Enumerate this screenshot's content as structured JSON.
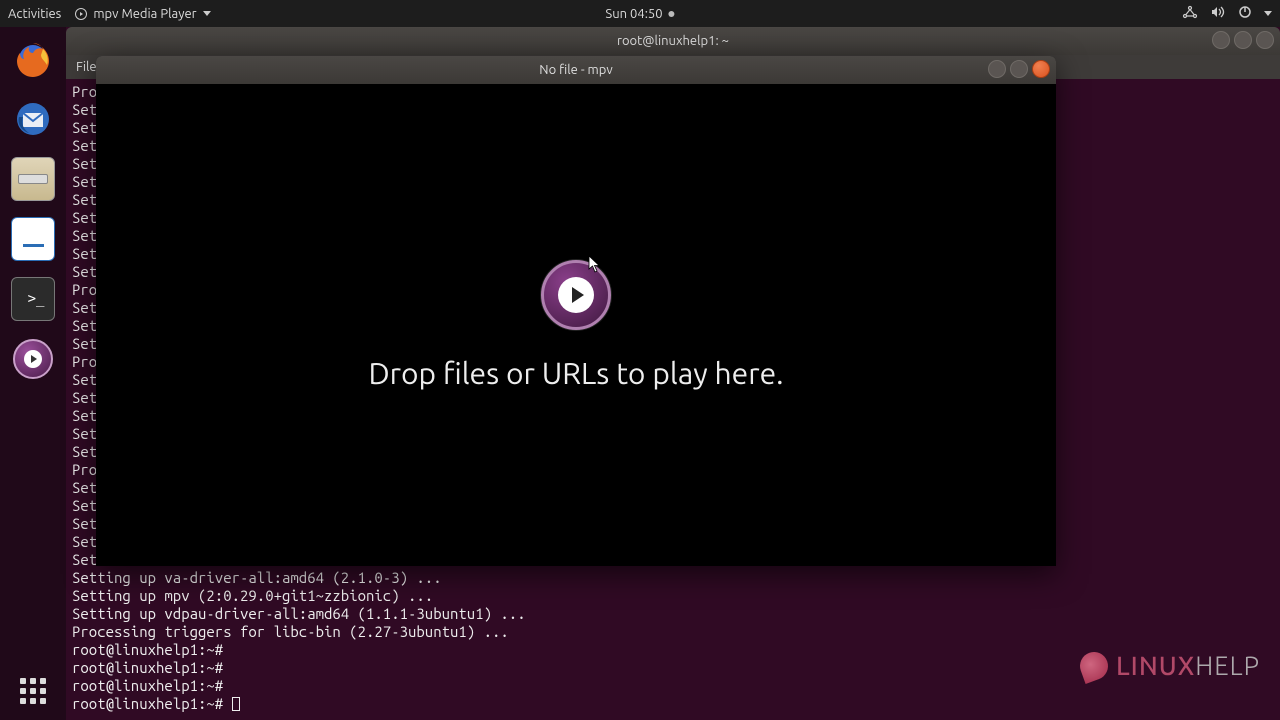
{
  "topbar": {
    "activities": "Activities",
    "app_name": "mpv Media Player",
    "clock": "Sun 04:50"
  },
  "terminal": {
    "title": "root@linuxhelp1: ~",
    "menu_file": "File",
    "lines_bg": [
      "Pro",
      "Set",
      "Set",
      "Set",
      "Set",
      "Set",
      "Set",
      "Set",
      "Set",
      "Set",
      "Set",
      "Pro",
      "Set",
      "Set",
      "Set",
      "Pro",
      "Set",
      "Set",
      "Set",
      "Set",
      "Set",
      "Pro",
      "Set",
      "Set",
      "Set",
      "Set",
      "Set"
    ],
    "lines_after": [
      "Setting up va-driver-all:amd64 (2.1.0-3) ...",
      "Setting up mpv (2:0.29.0+git1~zzbionic) ...",
      "Setting up vdpau-driver-all:amd64 (1.1.1-3ubuntu1) ...",
      "Processing triggers for libc-bin (2.27-3ubuntu1) ..."
    ],
    "prompt": "root@linuxhelp1:~#"
  },
  "mpv": {
    "title": "No file - mpv",
    "drop_text": "Drop files or URLs to play here."
  },
  "watermark": {
    "part1": "LINUX",
    "part2": "HELP"
  }
}
